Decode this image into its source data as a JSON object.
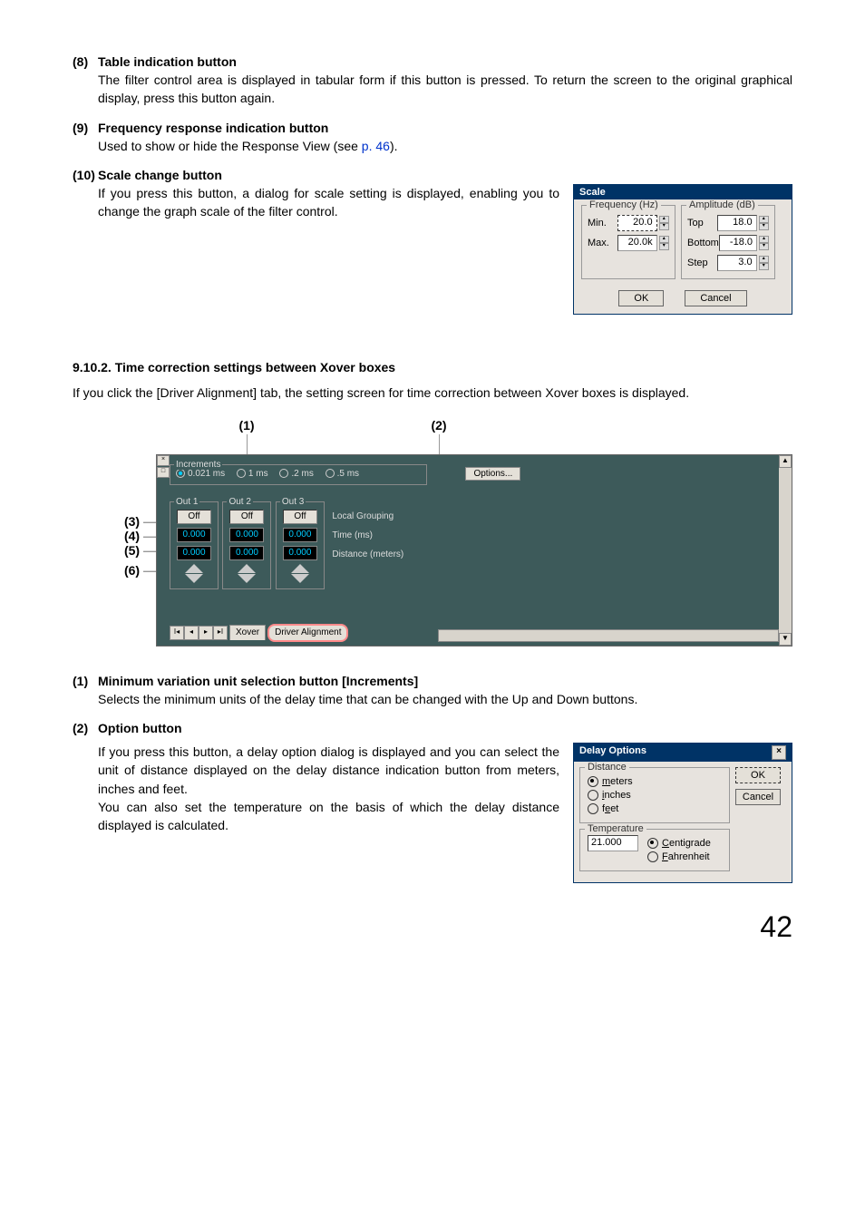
{
  "items": {
    "i8": {
      "num": "(8)",
      "title": "Table indication button",
      "body": "The filter control area is displayed in tabular form if this button is pressed. To return the screen to the original graphical display, press this button again."
    },
    "i9": {
      "num": "(9)",
      "title": "Frequency response indication button",
      "body_a": "Used to show or hide the Response View (see ",
      "link": "p. 46",
      "body_b": ")."
    },
    "i10": {
      "num": "(10)",
      "title": "Scale change button",
      "body": "If you press this button, a dialog for scale setting is displayed, enabling you to change the graph scale of the filter control."
    }
  },
  "scale": {
    "title": "Scale",
    "freq_legend": "Frequency (Hz)",
    "amp_legend": "Amplitude (dB)",
    "min_lab": "Min.",
    "min_val": "20.0",
    "max_lab": "Max.",
    "max_val": "20.0k",
    "top_lab": "Top",
    "top_val": "18.0",
    "bottom_lab": "Bottom",
    "bottom_val": "-18.0",
    "step_lab": "Step",
    "step_val": "3.0",
    "ok": "OK",
    "cancel": "Cancel"
  },
  "sec": {
    "head": "9.10.2. Time correction settings between Xover boxes",
    "body": "If you click the [Driver Alignment] tab, the setting screen for time correction between Xover boxes is displayed."
  },
  "top_callouts": {
    "c1": "(1)",
    "c2": "(2)"
  },
  "left_callouts": {
    "c3": "(3)",
    "c4": "(4)",
    "c5": "(5)",
    "c6": "(6)"
  },
  "app": {
    "incr_legend": "Increments",
    "r0": "0.021 ms",
    "r1": "1 ms",
    "r2": ".2 ms",
    "r3": ".5 ms",
    "options": "Options...",
    "out1": "Out 1",
    "out2": "Out 2",
    "out3": "Out 3",
    "off": "Off",
    "zero": "0.000",
    "local_grouping": "Local Grouping",
    "time_ms": "Time (ms)",
    "distance_m": "Distance (meters)",
    "tab_xover": "Xover",
    "tab_da": "Driver Alignment"
  },
  "items2": {
    "i1": {
      "num": "(1)",
      "title": "Minimum variation unit selection button [Increments]",
      "body": "Selects the minimum units of the delay time that can be changed with the Up and Down buttons."
    },
    "i2": {
      "num": "(2)",
      "title": "Option button",
      "body": "If you press this button, a delay option dialog is displayed and you can select the unit of distance displayed on the delay distance indication button from meters, inches and feet.",
      "body2": "You can also set the temperature on the basis of which the delay distance displayed is calculated."
    }
  },
  "delay": {
    "title": "Delay Options",
    "dist_legend": "Distance",
    "meters": "meters",
    "inches": "inches",
    "feet": "feet",
    "temp_legend": "Temperature",
    "temp_val": "21.000",
    "centigrade": "Centigrade",
    "fahrenheit": "Fahrenheit",
    "ok": "OK",
    "cancel": "Cancel"
  },
  "page_num": "42"
}
